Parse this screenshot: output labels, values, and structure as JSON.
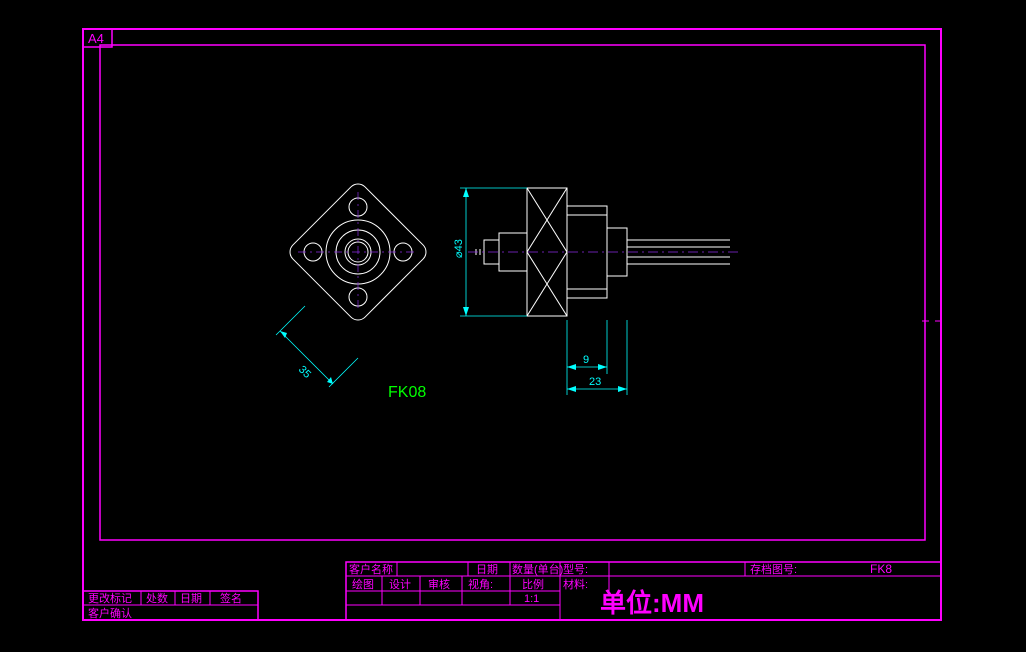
{
  "paper_size": "A4",
  "part_label": "FK08",
  "dimensions": {
    "left_diagonal": "35",
    "height_diameter": "⌀43",
    "short_h": "9",
    "long_h": "23"
  },
  "title_block": {
    "row_left_1_col1": "更改标记",
    "row_left_1_col2": "处数",
    "row_left_1_col3": "日期",
    "row_left_1_col4": "签名",
    "row_left_2": "客户确认",
    "main_row1_col1_label": "客户名称",
    "main_row1_col2_label": "日期",
    "main_row1_col3_label": "数量(单台)",
    "main_row1_col4_label": "型号:",
    "main_row1_col5_label": "存档图号:",
    "main_row1_col5_value": "FK8",
    "main_row2_col1": "绘图",
    "main_row2_col2": "设计",
    "main_row2_col3": "审核",
    "main_row2_col4": "视角:",
    "main_row2_col5": "比例",
    "main_row2_material": "材料:",
    "main_row3_scale": "1:1",
    "main_row3_units": "单位:MM"
  }
}
